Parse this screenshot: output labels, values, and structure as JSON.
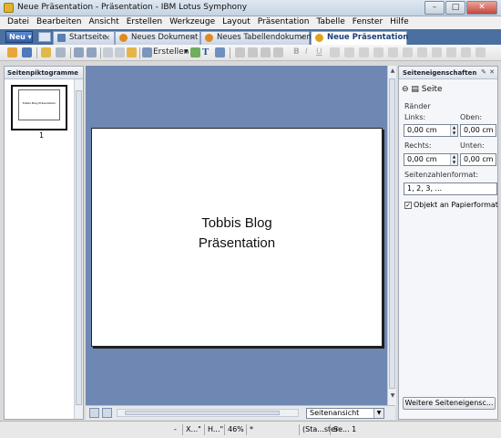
{
  "window": {
    "title": "Neue Präsentation - Präsentation - IBM Lotus Symphony"
  },
  "menu": [
    "Datei",
    "Bearbeiten",
    "Ansicht",
    "Erstellen",
    "Werkzeuge",
    "Layout",
    "Präsentation",
    "Tabelle",
    "Fenster",
    "Hilfe"
  ],
  "tabs": {
    "new_label": "Neu",
    "items": [
      {
        "label": "Startseite",
        "icon": "home-icon",
        "color": "#4a6fa0"
      },
      {
        "label": "Neues Dokument",
        "icon": "document-icon",
        "color": "#e08a1e"
      },
      {
        "label": "Neues Tabellendokument",
        "icon": "spreadsheet-icon",
        "color": "#e08a1e"
      },
      {
        "label": "Neue Präsentation",
        "icon": "presentation-icon",
        "color": "#e0a21e"
      }
    ]
  },
  "toolbar": {
    "create_label": "Erstellen"
  },
  "left_panel": {
    "title": "Seitenpiktogramme",
    "thumb_text": "Tobbis Blog Präsentation",
    "thumb_number": "1"
  },
  "slide": {
    "line1": "Tobbis Blog",
    "line2": "Präsentation"
  },
  "view_select": "Seitenansicht",
  "right_panel": {
    "title": "Seiteneigenschaften",
    "section": "Seite",
    "margins_label": "Ränder",
    "left_label": "Links:",
    "top_label": "Oben:",
    "right_label": "Rechts:",
    "bottom_label": "Unten:",
    "left_value": "0,00 cm",
    "top_value": "0,00 cm",
    "right_value": "0,00 cm",
    "bottom_value": "0,00 cm",
    "page_number_label": "Seitenzahlenformat:",
    "page_number_value": "1, 2, 3, ...",
    "fit_label": "Objekt an Papierformat an",
    "fit_checked": "✓",
    "more_button": "Weitere Seiteneigensc..."
  },
  "status": {
    "dash": "-",
    "x": "X...\"",
    "h": "H...\"",
    "zoom": "46%",
    "modified": "*",
    "style": "(Sta...ster",
    "page": "Se... 1"
  }
}
